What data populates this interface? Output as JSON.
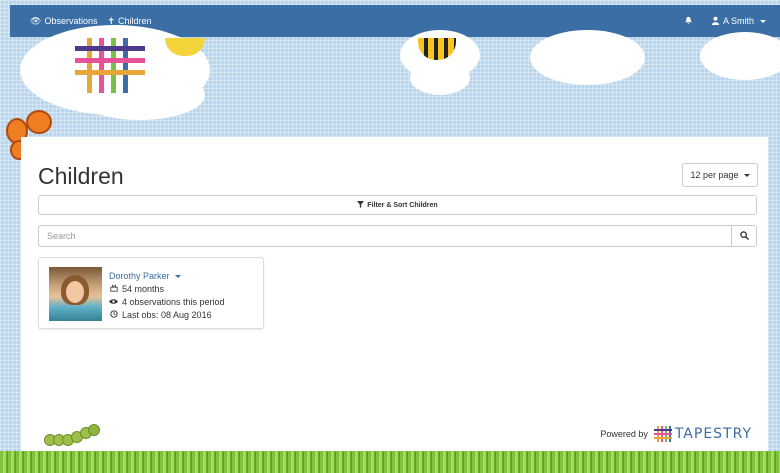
{
  "navbar": {
    "observations_label": "Observations",
    "children_label": "Children",
    "user_label": "A Smith"
  },
  "page": {
    "title": "Children",
    "per_page_label": "12 per page",
    "filter_label": "Filter & Sort Children"
  },
  "search": {
    "placeholder": "Search",
    "value": ""
  },
  "children": [
    {
      "name": "Dorothy Parker",
      "age": "54 months",
      "observations": "4 observations this period",
      "last_obs": "Last obs: 08 Aug 2016"
    }
  ],
  "footer": {
    "powered_by": "Powered by",
    "brand": "TAPESTRY"
  },
  "colors": {
    "navbar": "#3b6ea5",
    "link": "#3b6ea5",
    "background": "#b9d6ee"
  },
  "icons": {
    "observations": "eye-icon",
    "children": "child-icon",
    "notifications": "bell-icon",
    "user": "user-icon",
    "filter": "filter-icon",
    "search": "search-icon",
    "age": "birthday-cake-icon",
    "observations_count": "eye-icon",
    "last_obs": "clock-icon"
  }
}
